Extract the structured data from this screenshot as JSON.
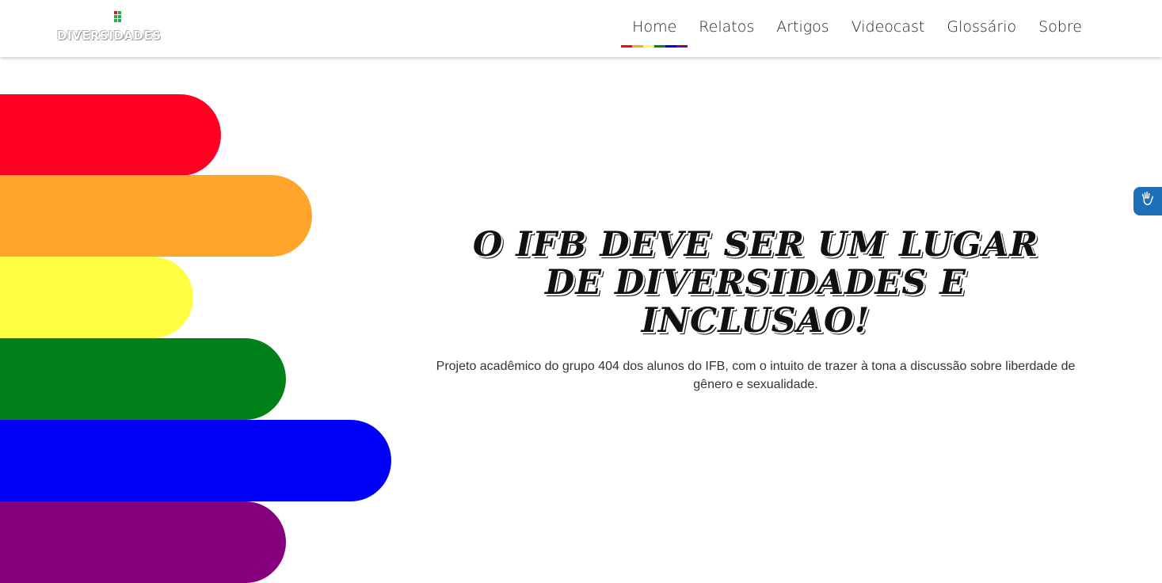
{
  "logo": {
    "text": "DIVERSIDADES"
  },
  "nav": {
    "items": [
      {
        "label": "Home",
        "active": true
      },
      {
        "label": "Relatos",
        "active": false
      },
      {
        "label": "Artigos",
        "active": false
      },
      {
        "label": "Videocast",
        "active": false
      },
      {
        "label": "Glossário",
        "active": false
      },
      {
        "label": "Sobre",
        "active": false
      }
    ]
  },
  "hero": {
    "title": "O IFB DEVE SER UM LUGAR DE DIVERSIDADES E INCLUSAO!",
    "subtitle": "Projeto acadêmico do grupo 404 dos alunos do IFB, com o intuito de trazer à tona a discussão sobre liberdade de gênero e sexualidade."
  },
  "accessibility": {
    "icon": "sign-language-hands-icon"
  },
  "colors": {
    "red": "#ff0022",
    "orange": "#ffa52c",
    "yellow": "#ffff41",
    "green": "#008018",
    "blue": "#0000f9",
    "purple": "#86007d",
    "accessibility_blue": "#1c6fb8"
  }
}
